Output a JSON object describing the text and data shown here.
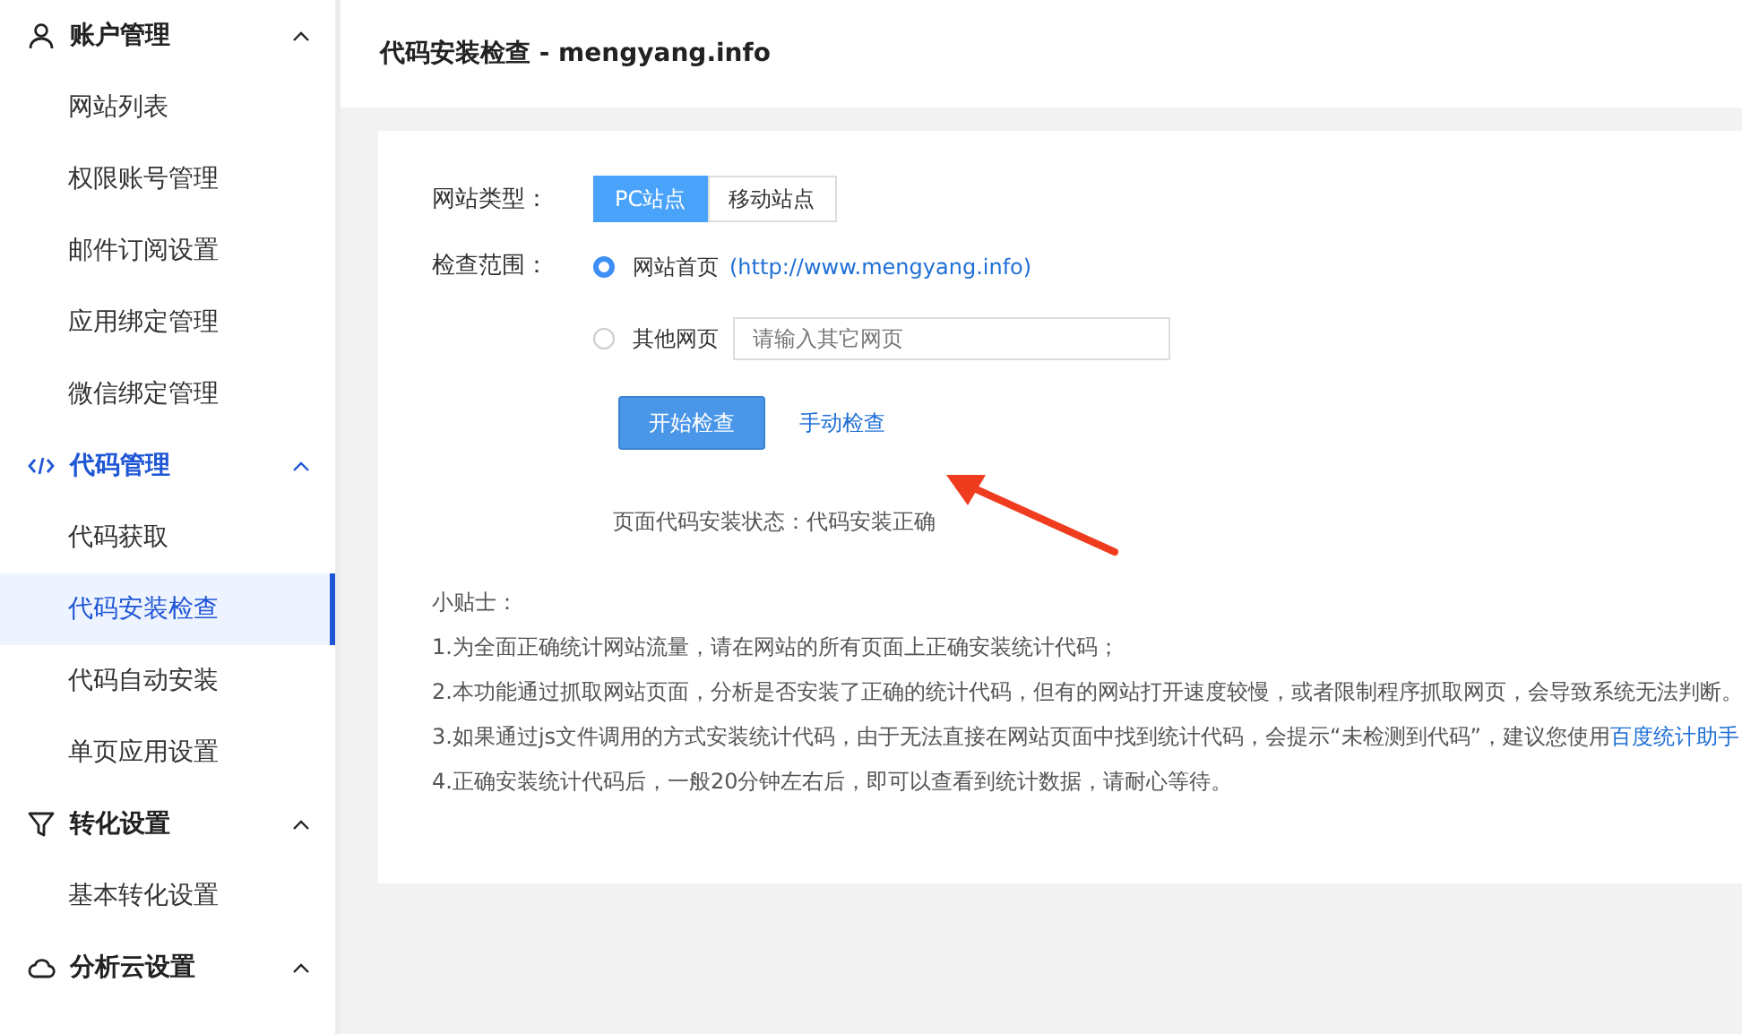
{
  "sidebar": {
    "groups": [
      {
        "label": "账户管理",
        "expanded": true,
        "active": false,
        "children": [
          {
            "label": "网站列表",
            "selected": false
          },
          {
            "label": "权限账号管理",
            "selected": false
          },
          {
            "label": "邮件订阅设置",
            "selected": false
          },
          {
            "label": "应用绑定管理",
            "selected": false
          },
          {
            "label": "微信绑定管理",
            "selected": false
          }
        ]
      },
      {
        "label": "代码管理",
        "expanded": true,
        "active": true,
        "children": [
          {
            "label": "代码获取",
            "selected": false
          },
          {
            "label": "代码安装检查",
            "selected": true
          },
          {
            "label": "代码自动安装",
            "selected": false
          },
          {
            "label": "单页应用设置",
            "selected": false
          }
        ]
      },
      {
        "label": "转化设置",
        "expanded": true,
        "active": false,
        "children": [
          {
            "label": "基本转化设置",
            "selected": false
          }
        ]
      },
      {
        "label": "分析云设置",
        "expanded": true,
        "active": false
      }
    ]
  },
  "header": {
    "title": "代码安装检查 - mengyang.info"
  },
  "form": {
    "site_type": {
      "label": "网站类型：",
      "options": [
        {
          "label": "PC站点",
          "selected": true
        },
        {
          "label": "移动站点",
          "selected": false
        }
      ]
    },
    "scope": {
      "label": "检查范围：",
      "options": [
        {
          "label": "网站首页",
          "selected": true,
          "link": "(http://www.mengyang.info)"
        },
        {
          "label": "其他网页",
          "selected": false,
          "placeholder": "请输入其它网页"
        }
      ]
    },
    "start_button": "开始检查",
    "manual_link": "手动检查",
    "status": "页面代码安装状态：代码安装正确"
  },
  "tips": {
    "title": "小贴士：",
    "items": [
      {
        "text": "1.为全面正确统计网站流量，请在网站的所有页面上正确安装统计代码；"
      },
      {
        "text": "2.本功能通过抓取网站页面，分析是否安装了正确的统计代码，但有的网站打开速度较慢，或者限制程序抓取网页，会导致系统无法判断。"
      },
      {
        "text": "3.如果通过js文件调用的方式安装统计代码，由于无法直接在网站页面中找到统计代码，会提示“未检测到代码”，建议您使用 ",
        "link": "百度统计助手"
      },
      {
        "text": "4.正确安装统计代码后，一般20分钟左右后，即可以查看到统计数据，请耐心等待。"
      }
    ]
  }
}
